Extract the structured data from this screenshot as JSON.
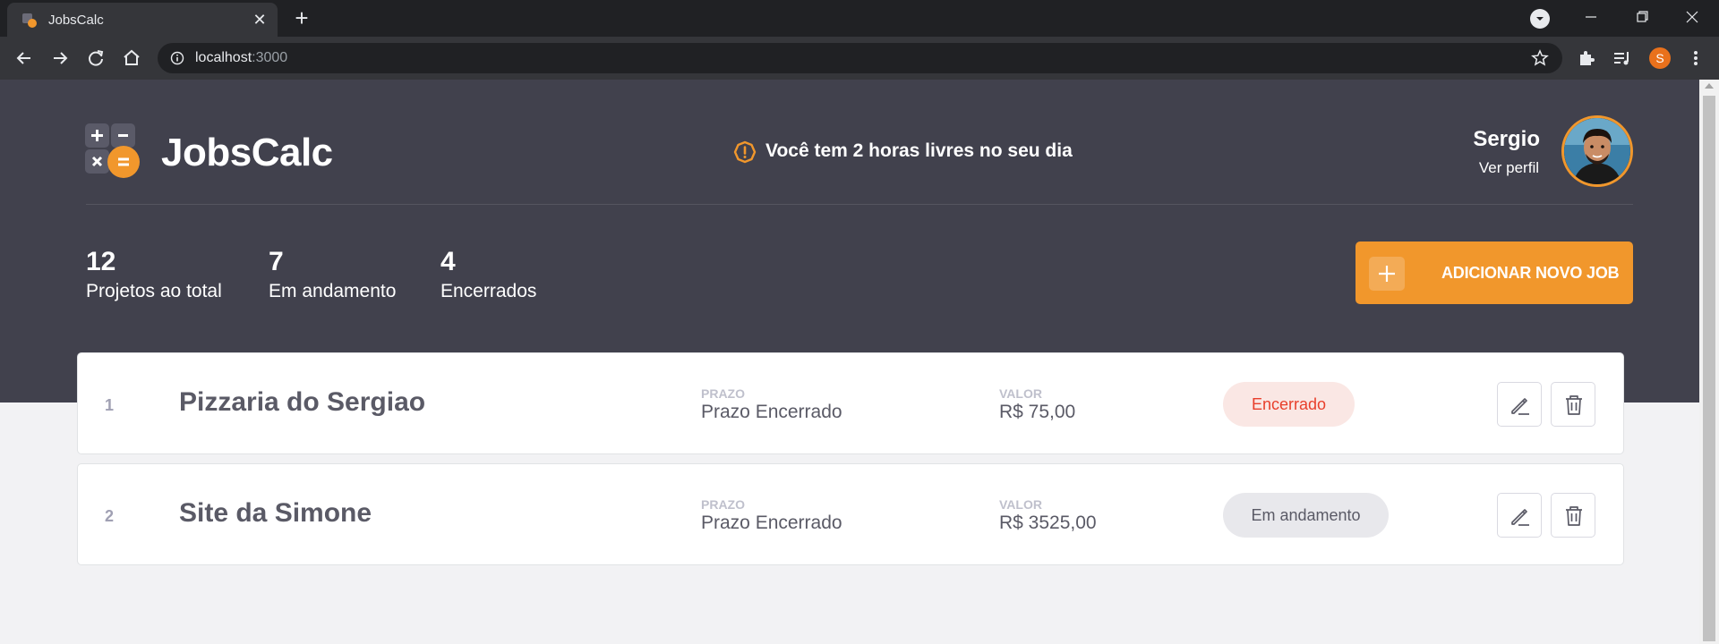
{
  "browser": {
    "tab_title": "JobsCalc",
    "url_host": "localhost",
    "url_port": ":3000",
    "profile_initial": "S"
  },
  "header": {
    "logo_text": "JobsCalc",
    "alert_text": "Você tem 2 horas livres no seu dia",
    "profile": {
      "name": "Sergio",
      "link": "Ver perfil"
    }
  },
  "summary": [
    {
      "value": "12",
      "label": "Projetos ao total"
    },
    {
      "value": "7",
      "label": "Em andamento"
    },
    {
      "value": "4",
      "label": "Encerrados"
    }
  ],
  "add_button_label": "ADICIONAR NOVO JOB",
  "jobs": [
    {
      "id": "1",
      "name": "Pizzaria do Sergiao",
      "deadline_label": "PRAZO",
      "deadline": "Prazo Encerrado",
      "value_label": "VALOR",
      "value": "R$ 75,00",
      "status": "Encerrado"
    },
    {
      "id": "2",
      "name": "Site da Simone",
      "deadline_label": "PRAZO",
      "deadline": "Prazo Encerrado",
      "value_label": "VALOR",
      "value": "R$ 3525,00",
      "status": "Em andamento"
    }
  ],
  "colors": {
    "accent": "#f1972c",
    "header_bg": "#41414d",
    "page_bg": "#f2f2f4",
    "closed_badge_bg": "#fae7e4",
    "closed_badge_text": "#e83f2b",
    "progress_badge_bg": "#e8e8ec"
  },
  "icons": {
    "edit": "pencil-icon",
    "delete": "trash-icon",
    "alert": "exclamation-circle-icon",
    "add": "plus-icon"
  }
}
